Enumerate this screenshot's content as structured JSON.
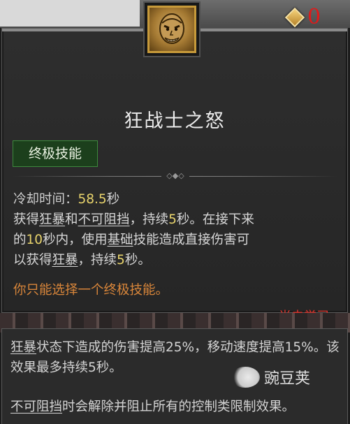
{
  "currency": {
    "count": "0",
    "icon": "gem-diamond-icon",
    "color": "#e01a1a"
  },
  "skill": {
    "title": "狂战士之怒",
    "tag": "终极技能",
    "cooldown_label": "冷却时间：",
    "cooldown_value": "58.5",
    "cooldown_unit": "秒",
    "desc": {
      "p1": "获得",
      "kw1": "狂暴",
      "p2": "和",
      "kw2": "不可阻挡",
      "p3": "，持续",
      "n1": "5",
      "p4": "秒。在接下来",
      "p5": "的",
      "n2": "10",
      "p6": "秒内，使用",
      "kw3": "基础",
      "p7": "技能造成直接伤害可",
      "p8": "以获得",
      "kw4": "狂暴",
      "p9": "，持续",
      "n3": "5",
      "p10": "秒。"
    },
    "note": "你只能选择一个终极技能。",
    "status": "尚未学习"
  },
  "keyword_tooltip": {
    "berserk_kw": "狂暴",
    "berserk_text": "状态下造成的伤害提高25%，移动速度提高15%。该效果最多持续5秒。",
    "unstoppable_kw": "不可阻挡",
    "unstoppable_text": "时会解除并阻止所有的控制类限制效果。"
  },
  "watermark": {
    "text": "豌豆荚"
  },
  "colors": {
    "number": "#e9d46c",
    "note": "#d9863a",
    "status": "#e0342c",
    "tag_bg": "#1c3f1c",
    "frame_gold": "#c79a3a"
  }
}
